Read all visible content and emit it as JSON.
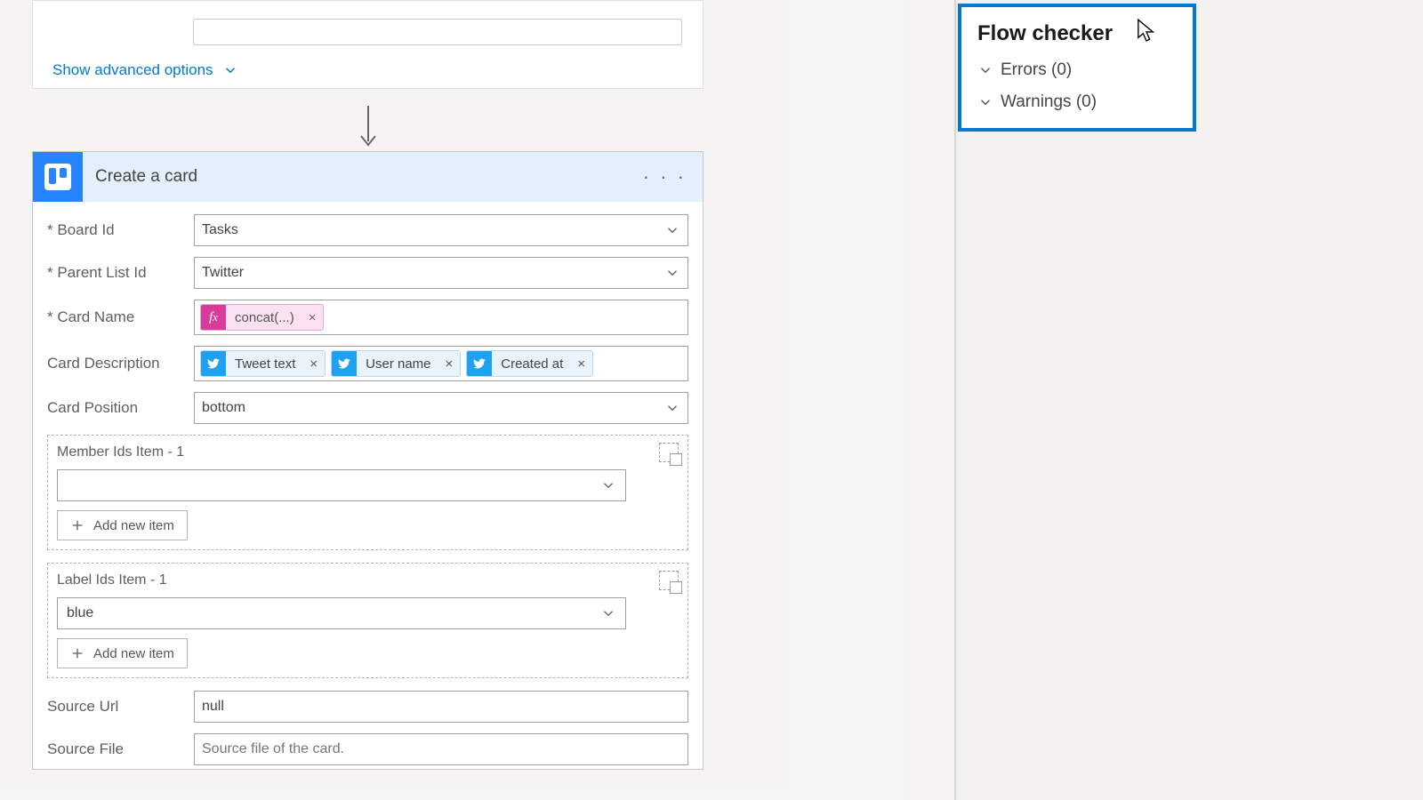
{
  "prev_step": {
    "show_advanced": "Show advanced options"
  },
  "step": {
    "title": "Create a card",
    "fields": {
      "board_id": {
        "label": "Board Id",
        "value": "Tasks",
        "required": true
      },
      "parent_list": {
        "label": "Parent List Id",
        "value": "Twitter",
        "required": true
      },
      "card_name": {
        "label": "Card Name",
        "required": true,
        "fx_token": "concat(...)"
      },
      "card_desc": {
        "label": "Card Description",
        "tokens": [
          "Tweet text",
          "User name",
          "Created at"
        ]
      },
      "card_position": {
        "label": "Card Position",
        "value": "bottom"
      },
      "source_url": {
        "label": "Source Url",
        "value": "null"
      },
      "source_file": {
        "label": "Source File",
        "placeholder": "Source file of the card."
      }
    },
    "member_group": {
      "title": "Member Ids Item - 1",
      "value": "",
      "add_label": "Add new item"
    },
    "label_group": {
      "title": "Label Ids Item - 1",
      "value": "blue",
      "add_label": "Add new item"
    }
  },
  "flow_checker": {
    "title": "Flow checker",
    "errors_label": "Errors (0)",
    "warnings_label": "Warnings (0)"
  }
}
